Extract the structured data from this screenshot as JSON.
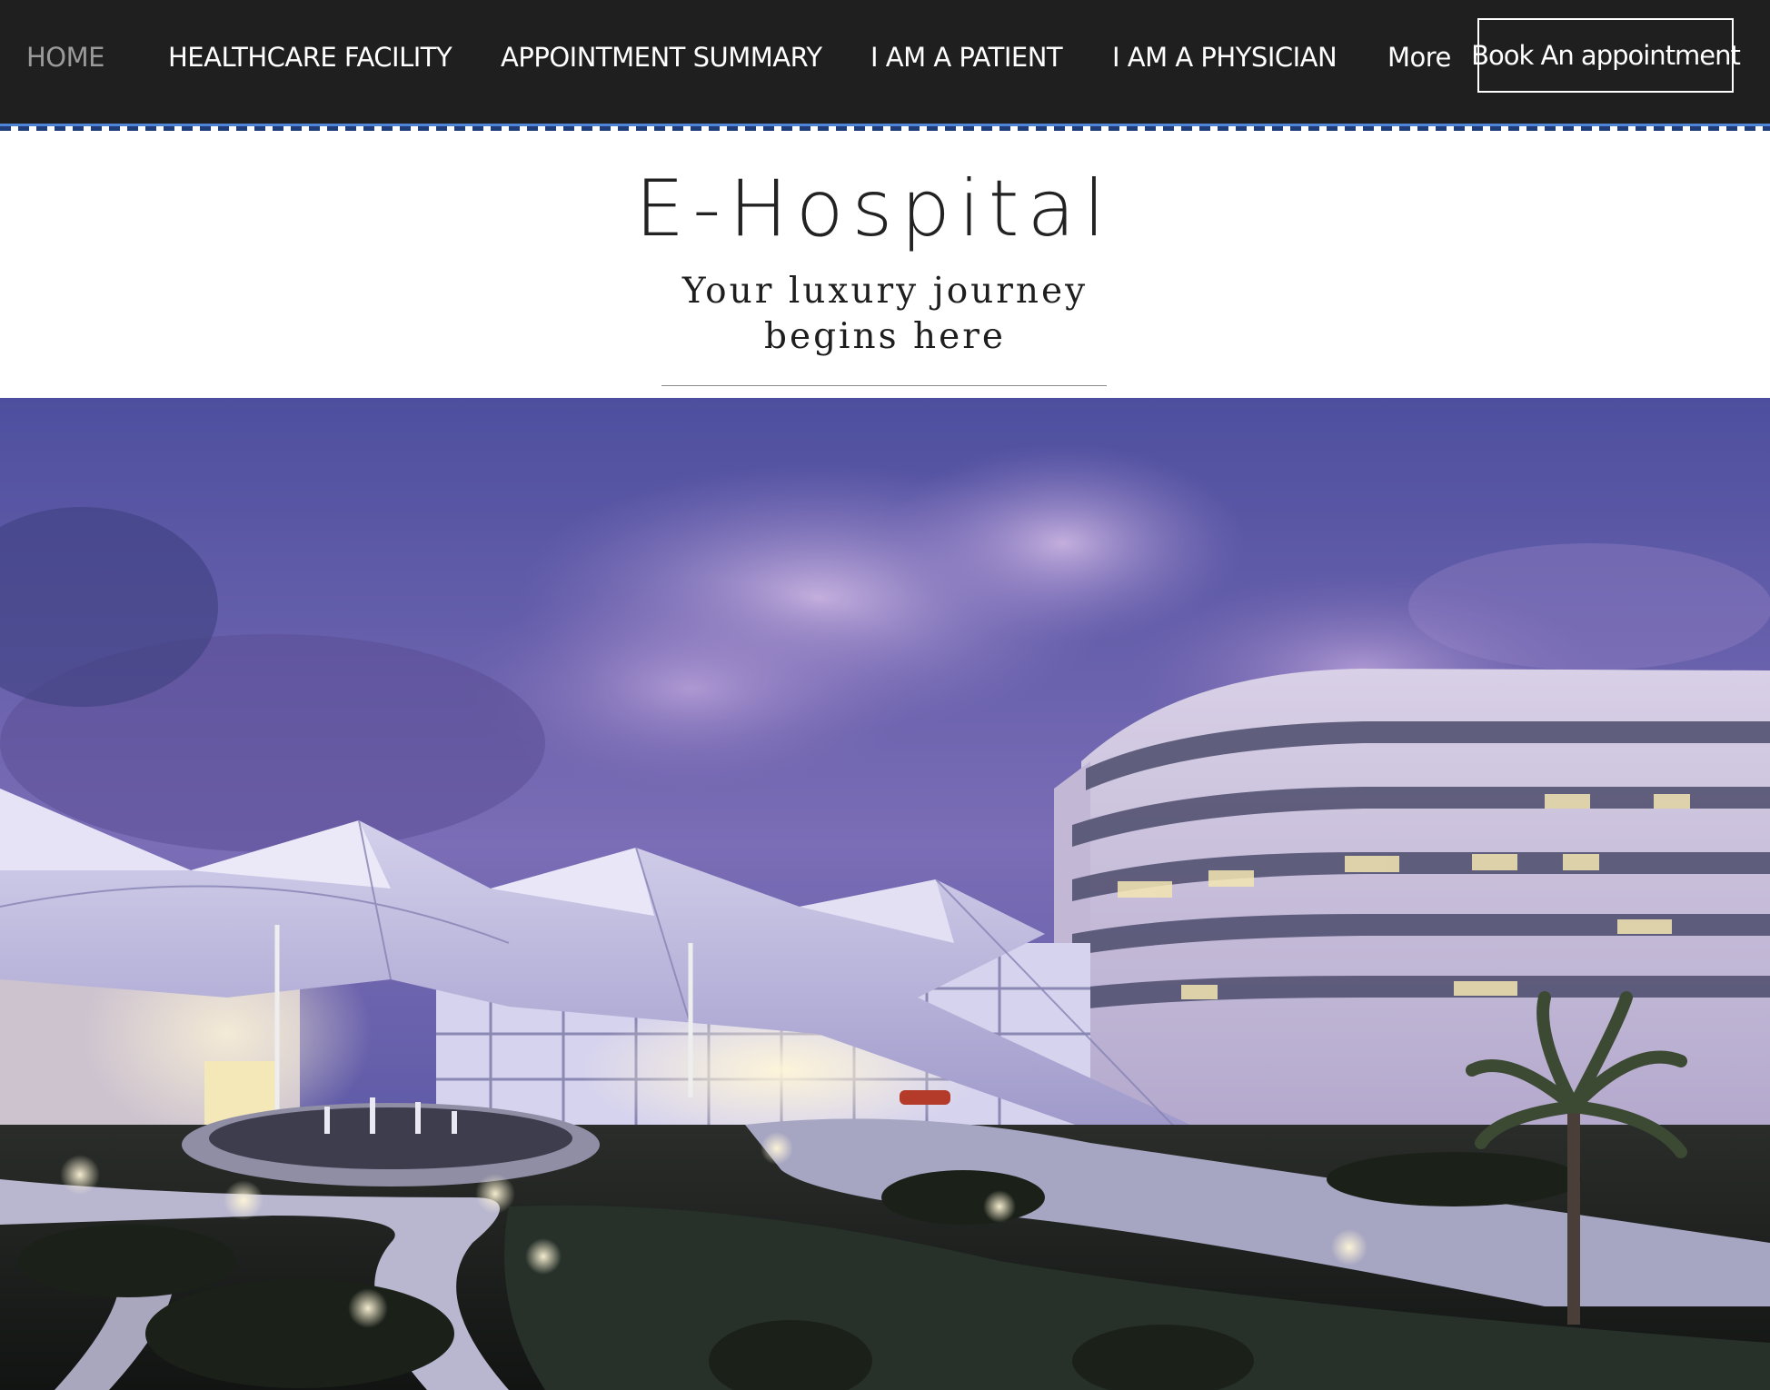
{
  "nav": {
    "items": [
      {
        "label": "HOME",
        "active": true
      },
      {
        "label": "HEALTHCARE FACILITY",
        "active": false
      },
      {
        "label": "APPOINTMENT SUMMARY",
        "active": false
      },
      {
        "label": "I AM A PATIENT",
        "active": false
      },
      {
        "label": "I AM A PHYSICIAN",
        "active": false
      }
    ],
    "more_label": "More",
    "book_label": "Book An appointment"
  },
  "header": {
    "title": "E-Hospital",
    "tagline_line1": "Your luxury journey",
    "tagline_line2": "begins here"
  },
  "hero": {
    "alt_description_icon": "hospital-building-photo"
  },
  "colors": {
    "nav_bg": "#1f1f1f",
    "nav_active": "#9a9a9a",
    "nav_stripe": "#4f85d6",
    "sky_top": "#4a4f9a",
    "sky_mid": "#7c6fb8"
  }
}
